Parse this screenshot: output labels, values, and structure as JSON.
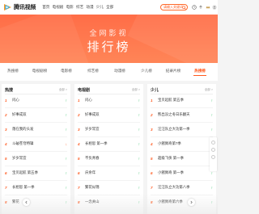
{
  "brand": {
    "name": "腾讯视频",
    "accent": "#ff5a1f",
    "icon": "tencent-video-logo"
  },
  "nav": {
    "links": [
      "首页",
      "电视剧",
      "电影",
      "综艺",
      "动漫",
      "少儿",
      "全部"
    ]
  },
  "search": {
    "placeholder": "请输入关键词"
  },
  "hero": {
    "subtitle": "全网影视",
    "title": "排行榜"
  },
  "tabs": [
    {
      "label": "热搜榜",
      "active": false
    },
    {
      "label": "电视剧榜",
      "active": false
    },
    {
      "label": "电影榜",
      "active": false
    },
    {
      "label": "综艺榜",
      "active": false
    },
    {
      "label": "动漫榜",
      "active": false
    },
    {
      "label": "少儿榜",
      "active": false
    },
    {
      "label": "纪录片榜",
      "active": false
    },
    {
      "label": "热搜榜",
      "active": true
    }
  ],
  "columns": [
    {
      "title": "热搜",
      "more": "全部 >",
      "items": [
        {
          "rank": "1",
          "title": "问心",
          "trend": "up"
        },
        {
          "rank": "2",
          "title": "好事成双",
          "trend": "up"
        },
        {
          "rank": "3",
          "title": "落在我的头发",
          "trend": "up"
        },
        {
          "rank": "4",
          "title": "斗破苍穹特辑",
          "trend": "down"
        },
        {
          "rank": "5",
          "title": "岁岁常宜",
          "trend": "up"
        },
        {
          "rank": "6",
          "title": "宝贝起航 第五季",
          "trend": "up"
        },
        {
          "rank": "7",
          "title": "长相思 第一季",
          "trend": "up"
        },
        {
          "rank": "8",
          "title": "繁花",
          "trend": "up"
        }
      ]
    },
    {
      "title": "电视剧",
      "more": "全部 >",
      "items": [
        {
          "rank": "1",
          "title": "问心",
          "trend": "up"
        },
        {
          "rank": "2",
          "title": "好事成双",
          "trend": "up"
        },
        {
          "rank": "3",
          "title": "岁岁常宜",
          "trend": "up"
        },
        {
          "rank": "4",
          "title": "长相思 第一季",
          "trend": "up"
        },
        {
          "rank": "5",
          "title": "不负青春",
          "trend": "up"
        },
        {
          "rank": "6",
          "title": "庆余年",
          "trend": "up"
        },
        {
          "rank": "7",
          "title": "繁花似锦",
          "trend": "up"
        },
        {
          "rank": "8",
          "title": "一念关山",
          "trend": "up"
        }
      ]
    },
    {
      "title": "少儿",
      "more": "全部 >",
      "items": [
        {
          "rank": "1",
          "title": "宝贝起航 第五季",
          "trend": "up"
        },
        {
          "rank": "2",
          "title": "熊出没之冬日乐翻天",
          "trend": "up"
        },
        {
          "rank": "3",
          "title": "汪汪队立大功第一季",
          "trend": "up"
        },
        {
          "rank": "4",
          "title": "小猪佩奇第7季",
          "trend": "up"
        },
        {
          "rank": "5",
          "title": "超级飞侠 第一季",
          "trend": "up"
        },
        {
          "rank": "6",
          "title": "小猪佩奇 第一季",
          "trend": "up"
        },
        {
          "rank": "7",
          "title": "汪汪队立大功第八季",
          "trend": "up"
        },
        {
          "rank": "8",
          "title": "小猪佩奇第六季",
          "trend": "up"
        }
      ]
    }
  ]
}
